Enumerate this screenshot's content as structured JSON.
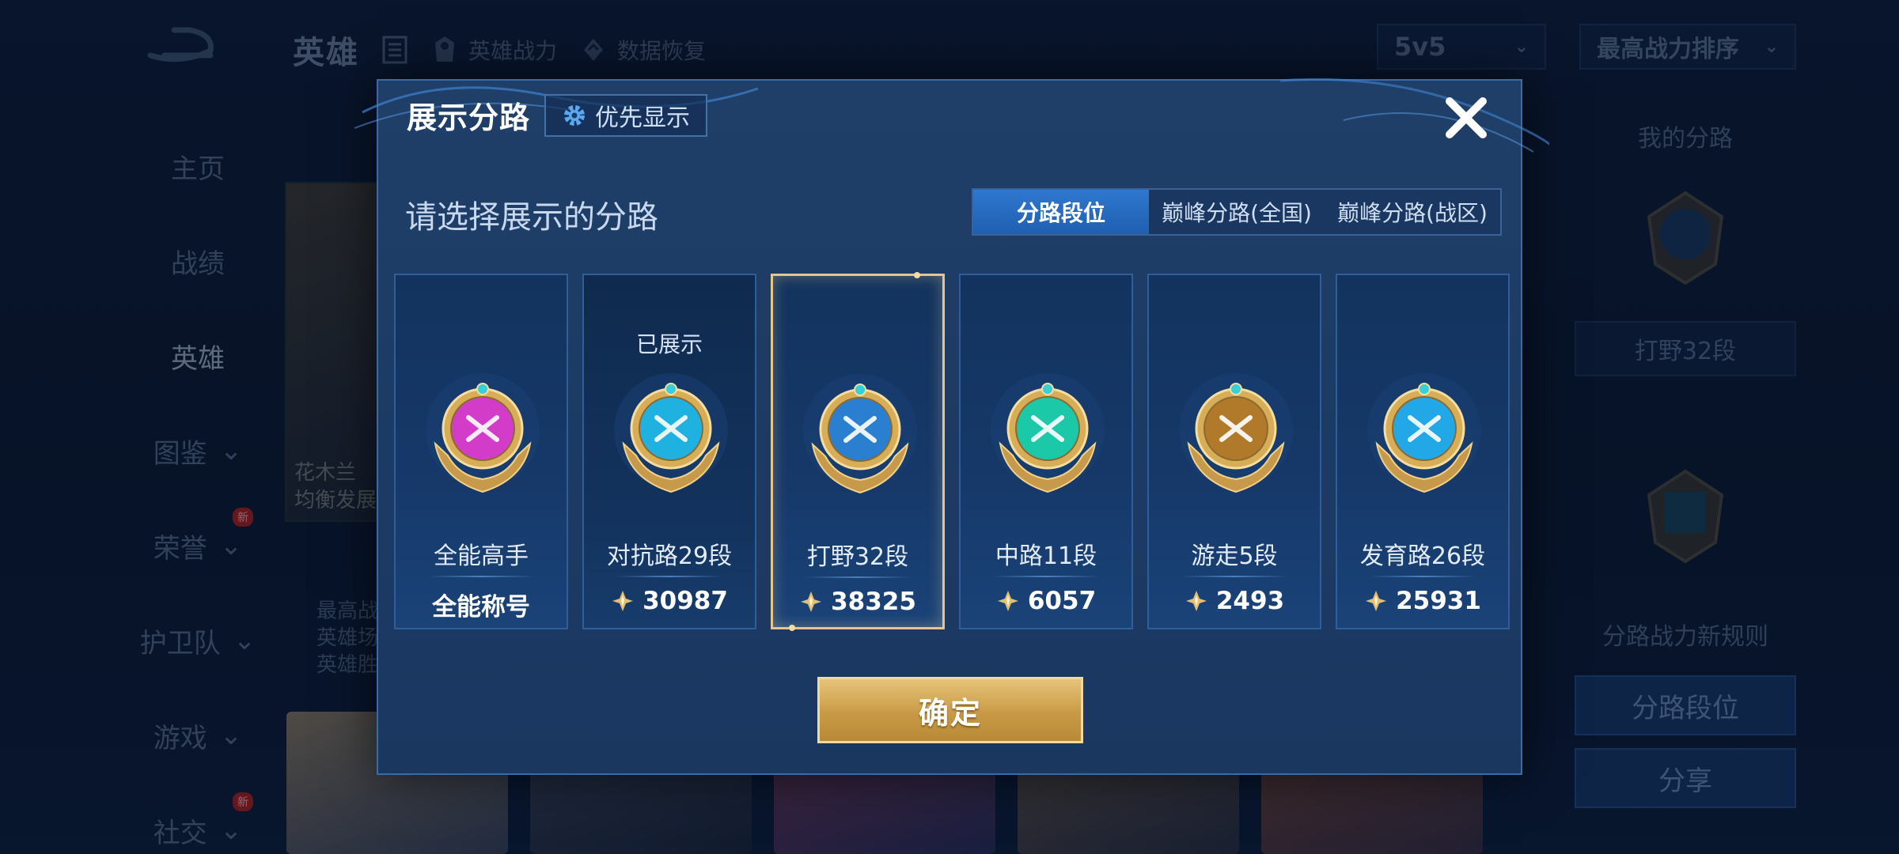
{
  "background": {
    "section_title": "英雄",
    "topnav": [
      {
        "label": "英雄战力",
        "icon": "warrior-icon"
      },
      {
        "label": "数据恢复",
        "icon": "restore-icon"
      }
    ],
    "mode_select": "5v5",
    "sort_select": "最高战力排序",
    "sidebar": [
      {
        "label": "主页"
      },
      {
        "label": "战绩"
      },
      {
        "label": "英雄"
      },
      {
        "label": "图鉴"
      },
      {
        "label": "荣誉",
        "badge": "新"
      },
      {
        "label": "护卫队"
      },
      {
        "label": "游戏"
      },
      {
        "label": "社交",
        "badge": "新"
      }
    ],
    "hero_info": [
      "最高战",
      "英雄场",
      "英雄胜"
    ],
    "hero_card_text": [
      "花木兰",
      "均衡发展"
    ],
    "right_panel": {
      "my_lane_label": "我的分路",
      "current_lane": "打野32段",
      "new_rules": "分路战力新规则",
      "lane_rank_button": "分路段位",
      "share_button": "分享"
    }
  },
  "dialog": {
    "title": "展示分路",
    "priority_button": "优先显示",
    "subtitle": "请选择展示的分路",
    "tabs": [
      {
        "label": "分路段位",
        "active": true
      },
      {
        "label": "巅峰分路(全国)",
        "active": false
      },
      {
        "label": "巅峰分路(战区)",
        "active": false
      }
    ],
    "cards": [
      {
        "lane": "全能高手",
        "bottom": "全能称号",
        "has_score": false,
        "shown": "",
        "emblem": "allround-emblem-icon",
        "color": "#d23cc8"
      },
      {
        "lane": "对抗路29段",
        "bottom": "30987",
        "has_score": true,
        "shown": "已展示",
        "emblem": "clash-lane-emblem-icon",
        "color": "#1fb2e0"
      },
      {
        "lane": "打野32段",
        "bottom": "38325",
        "has_score": true,
        "shown": "",
        "emblem": "jungle-emblem-icon",
        "color": "#2a7fd0",
        "selected": true
      },
      {
        "lane": "中路11段",
        "bottom": "6057",
        "has_score": true,
        "shown": "",
        "emblem": "mid-lane-emblem-icon",
        "color": "#1bc8a8"
      },
      {
        "lane": "游走5段",
        "bottom": "2493",
        "has_score": true,
        "shown": "",
        "emblem": "roam-emblem-icon",
        "color": "#b07a2a"
      },
      {
        "lane": "发育路26段",
        "bottom": "25931",
        "has_score": true,
        "shown": "",
        "emblem": "farm-lane-emblem-icon",
        "color": "#22a8e6"
      }
    ],
    "confirm_button": "确定"
  }
}
